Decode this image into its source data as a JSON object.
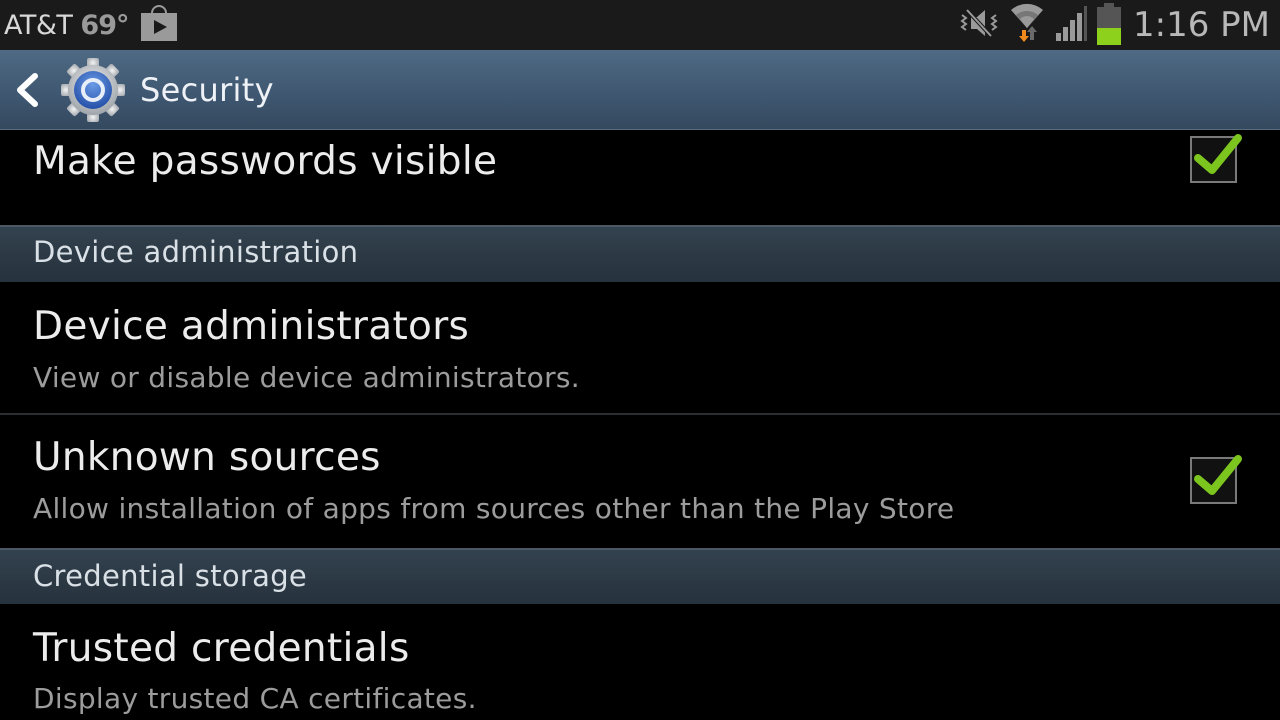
{
  "status_bar": {
    "carrier": "AT&T",
    "temperature": "69°",
    "notification_icons": [
      "play-store-icon"
    ],
    "system_icons": [
      "mute-vibrate-icon",
      "wifi-icon",
      "signal-icon",
      "battery-icon"
    ],
    "battery_level_percent": 45,
    "battery_color": "#8ed11c",
    "time": "1:16 PM"
  },
  "action_bar": {
    "title": "Security",
    "back_icon": "chevron-left-icon",
    "app_icon": "settings-gear-icon"
  },
  "list": {
    "items": [
      {
        "type": "item",
        "primary": "Make passwords visible",
        "checkbox": true,
        "checked": true
      },
      {
        "type": "header",
        "label": "Device administration"
      },
      {
        "type": "item",
        "primary": "Device administrators",
        "secondary": "View or disable device administrators."
      },
      {
        "type": "item",
        "primary": "Unknown sources",
        "secondary": "Allow installation of apps from sources other than the Play Store",
        "checkbox": true,
        "checked": true
      },
      {
        "type": "header",
        "label": "Credential storage"
      },
      {
        "type": "item",
        "primary": "Trusted credentials",
        "secondary": "Display trusted CA certificates."
      }
    ]
  },
  "colors": {
    "checkmark": "#7cc51f",
    "action_bar": "#3e5670",
    "section_header": "#2c3a46"
  }
}
